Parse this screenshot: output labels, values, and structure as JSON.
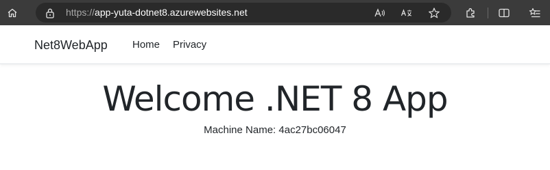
{
  "browser": {
    "url_scheme": "https://",
    "url_host": "app-yuta-dotnet8.azurewebsites.net"
  },
  "navbar": {
    "brand": "Net8WebApp",
    "links": [
      {
        "label": "Home"
      },
      {
        "label": "Privacy"
      }
    ]
  },
  "main": {
    "heading": "Welcome .NET 8 App",
    "machine_name": "Machine Name: 4ac27bc06047"
  }
}
